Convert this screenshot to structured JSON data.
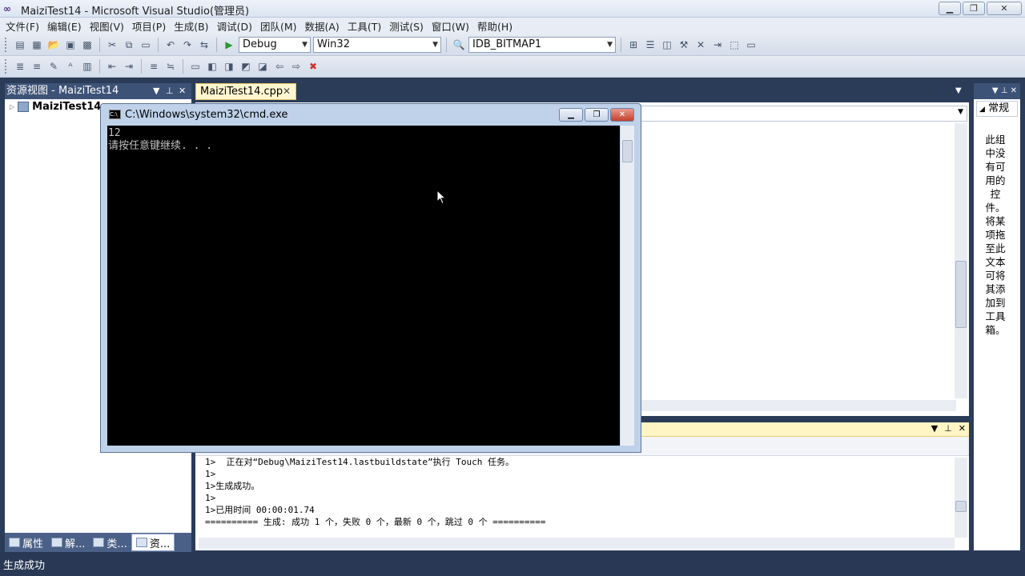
{
  "window": {
    "title": "MaiziTest14 - Microsoft Visual Studio(管理员)",
    "min_icon": "▁",
    "max_icon": "❐",
    "close_icon": "✕"
  },
  "menu": [
    "文件(F)",
    "编辑(E)",
    "视图(V)",
    "项目(P)",
    "生成(B)",
    "调试(D)",
    "团队(M)",
    "数据(A)",
    "工具(T)",
    "测试(S)",
    "窗口(W)",
    "帮助(H)"
  ],
  "toolbar": {
    "config": "Debug",
    "platform": "Win32",
    "resource_id": "IDB_BITMAP1"
  },
  "left_panel": {
    "title": "资源视图 - MaiziTest14",
    "tree_root": "MaiziTest14",
    "bottom_tabs": [
      "属性",
      "解...",
      "类...",
      "资..."
    ]
  },
  "document": {
    "tab_label": "MaiziTest14.cpp"
  },
  "output": {
    "lines": [
      "1>  正在对“Debug\\MaiziTest14.lastbuildstate”执行 Touch 任务。",
      "1>",
      "1>生成成功。",
      "1>",
      "1>已用时间 00:00:01.74",
      "========== 生成: 成功 1 个，失败 0 个，最新 0 个，跳过 0 个 =========="
    ]
  },
  "toolbox": {
    "group": "常规",
    "empty_text": "此组中没有可用的控件。将某项拖至此文本可将其添加到工具箱。"
  },
  "cmd": {
    "title": "C:\\Windows\\system32\\cmd.exe",
    "line1": "12",
    "line2": "请按任意键继续. . ."
  },
  "status": {
    "text": "生成成功"
  }
}
